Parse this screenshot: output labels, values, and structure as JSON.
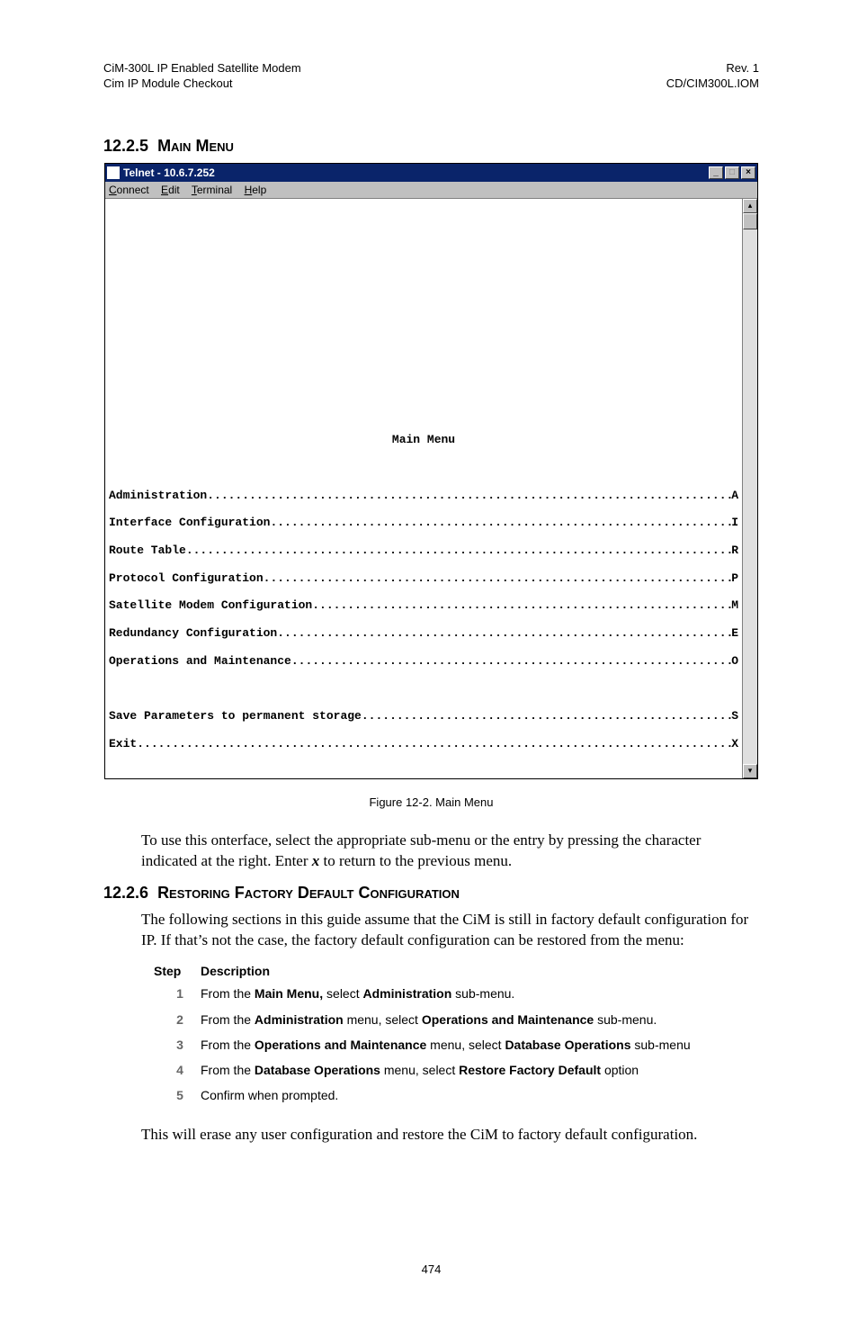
{
  "header": {
    "left1": "CiM-300L IP Enabled Satellite Modem",
    "left2": "Cim IP Module Checkout",
    "right1": "Rev. 1",
    "right2": "CD/CIM300L.IOM"
  },
  "section1": {
    "num": "12.2.5",
    "title": "Main Menu"
  },
  "telnet": {
    "title": "Telnet - 10.6.7.252",
    "menus": {
      "connect": "Connect",
      "edit": "Edit",
      "terminal": "Terminal",
      "help": "Help"
    },
    "menuTitle": "Main Menu",
    "items": [
      {
        "label": "Administration",
        "key": "A"
      },
      {
        "label": "Interface Configuration",
        "key": "I"
      },
      {
        "label": "Route Table",
        "key": "R"
      },
      {
        "label": "Protocol Configuration",
        "key": "P"
      },
      {
        "label": "Satellite Modem Configuration",
        "key": "M"
      },
      {
        "label": "Redundancy Configuration",
        "key": "E"
      },
      {
        "label": "Operations and Maintenance",
        "key": "O"
      }
    ],
    "items2": [
      {
        "label": "Save Parameters to permanent storage",
        "key": "S"
      },
      {
        "label": "Exit",
        "key": "X"
      }
    ]
  },
  "figureCaption": "Figure 12-2.  Main Menu",
  "para1a": "To use this onterface, select the appropriate sub-menu or the entry by pressing the character indicated at the right. Enter ",
  "para1x": "x",
  "para1b": " to return to the previous menu.",
  "section2": {
    "num": "12.2.6",
    "title": "Restoring Factory Default Configuration"
  },
  "para2": "The following sections in this guide assume that the CiM is still in factory default configuration for IP. If that’s not the case, the factory default configuration can be restored from the menu:",
  "stepsHeader": {
    "step": "Step",
    "desc": "Description"
  },
  "steps": [
    {
      "n": "1",
      "pre": "From the ",
      "b1": "Main Menu,",
      "mid": " select ",
      "b2": "Administration",
      "post": " sub-menu."
    },
    {
      "n": "2",
      "pre": "From the ",
      "b1": "Administration",
      "mid": " menu, select ",
      "b2": "Operations and Maintenance",
      "post": " sub-menu."
    },
    {
      "n": "3",
      "pre": "From the ",
      "b1": "Operations and Maintenance",
      "mid": " menu, select ",
      "b2": "Database Operations",
      "post": " sub-menu"
    },
    {
      "n": "4",
      "pre": "From the ",
      "b1": "Database Operations",
      "mid": " menu, select ",
      "b2": "Restore Factory Default",
      "post": " option"
    },
    {
      "n": "5",
      "pre": "Confirm when prompted.",
      "b1": "",
      "mid": "",
      "b2": "",
      "post": ""
    }
  ],
  "para3": "This will erase any user configuration and restore the CiM to factory default configuration.",
  "pageNumber": "474"
}
